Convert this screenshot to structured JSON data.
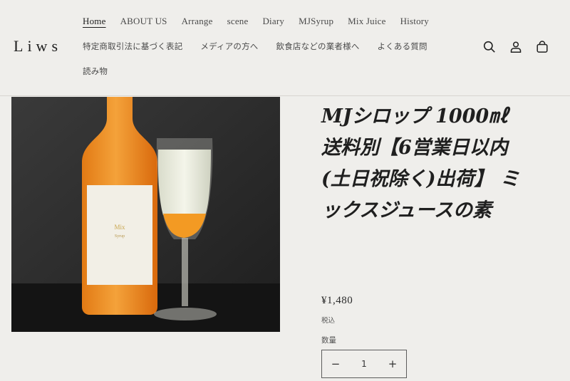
{
  "header": {
    "logo": "Liws",
    "nav_row1": [
      "Home",
      "ABOUT US",
      "Arrange",
      "scene",
      "Diary",
      "MJSyrup",
      "Mix Juice",
      "History"
    ],
    "nav_row2": [
      "特定商取引法に基づく表記",
      "メディアの方へ",
      "飲食店などの業者様へ",
      "よくある質問"
    ],
    "nav_row3": [
      "読み物"
    ],
    "active_nav": "Home",
    "icons": [
      "search-icon",
      "account-icon",
      "cart-icon"
    ]
  },
  "product": {
    "title": "MJシロップ 1000㎖ 送料別【6営業日以内(土日祝除く)出荷】 ミックスジュースの素",
    "price": "¥1,480",
    "tax_note": "税込",
    "quantity_label": "数量",
    "quantity_value": "1",
    "minus": "−",
    "plus": "+",
    "image_label": {
      "brand": "Mix",
      "sub": "Syrup"
    }
  }
}
